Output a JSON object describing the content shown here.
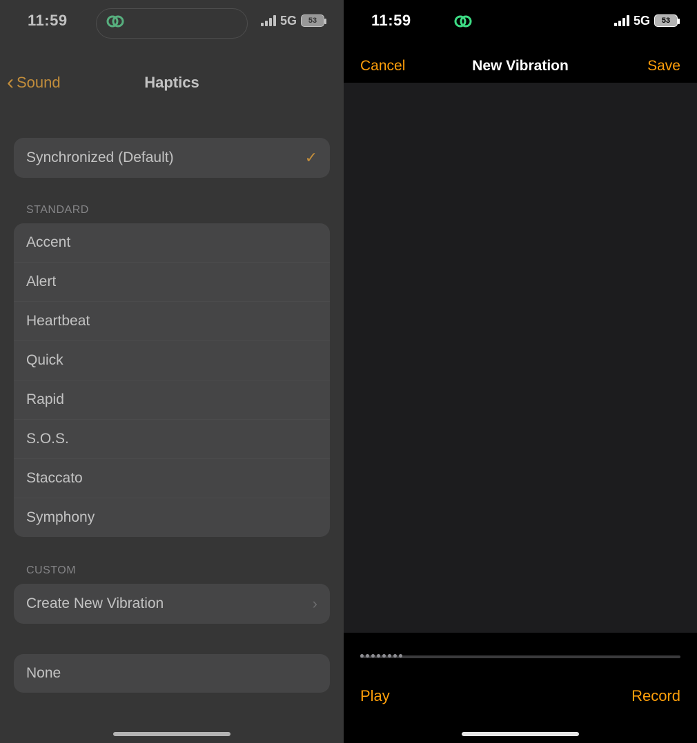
{
  "status": {
    "time": "11:59",
    "network": "5G",
    "battery": "53"
  },
  "left": {
    "back_label": "Sound",
    "title": "Haptics",
    "default_item": "Synchronized (Default)",
    "section_standard": "STANDARD",
    "standard_items": [
      "Accent",
      "Alert",
      "Heartbeat",
      "Quick",
      "Rapid",
      "S.O.S.",
      "Staccato",
      "Symphony"
    ],
    "section_custom": "CUSTOM",
    "create_new": "Create New Vibration",
    "none": "None"
  },
  "right": {
    "cancel": "Cancel",
    "title": "New Vibration",
    "save": "Save",
    "play": "Play",
    "record": "Record"
  },
  "colors": {
    "accent": "#ff9f0a"
  }
}
